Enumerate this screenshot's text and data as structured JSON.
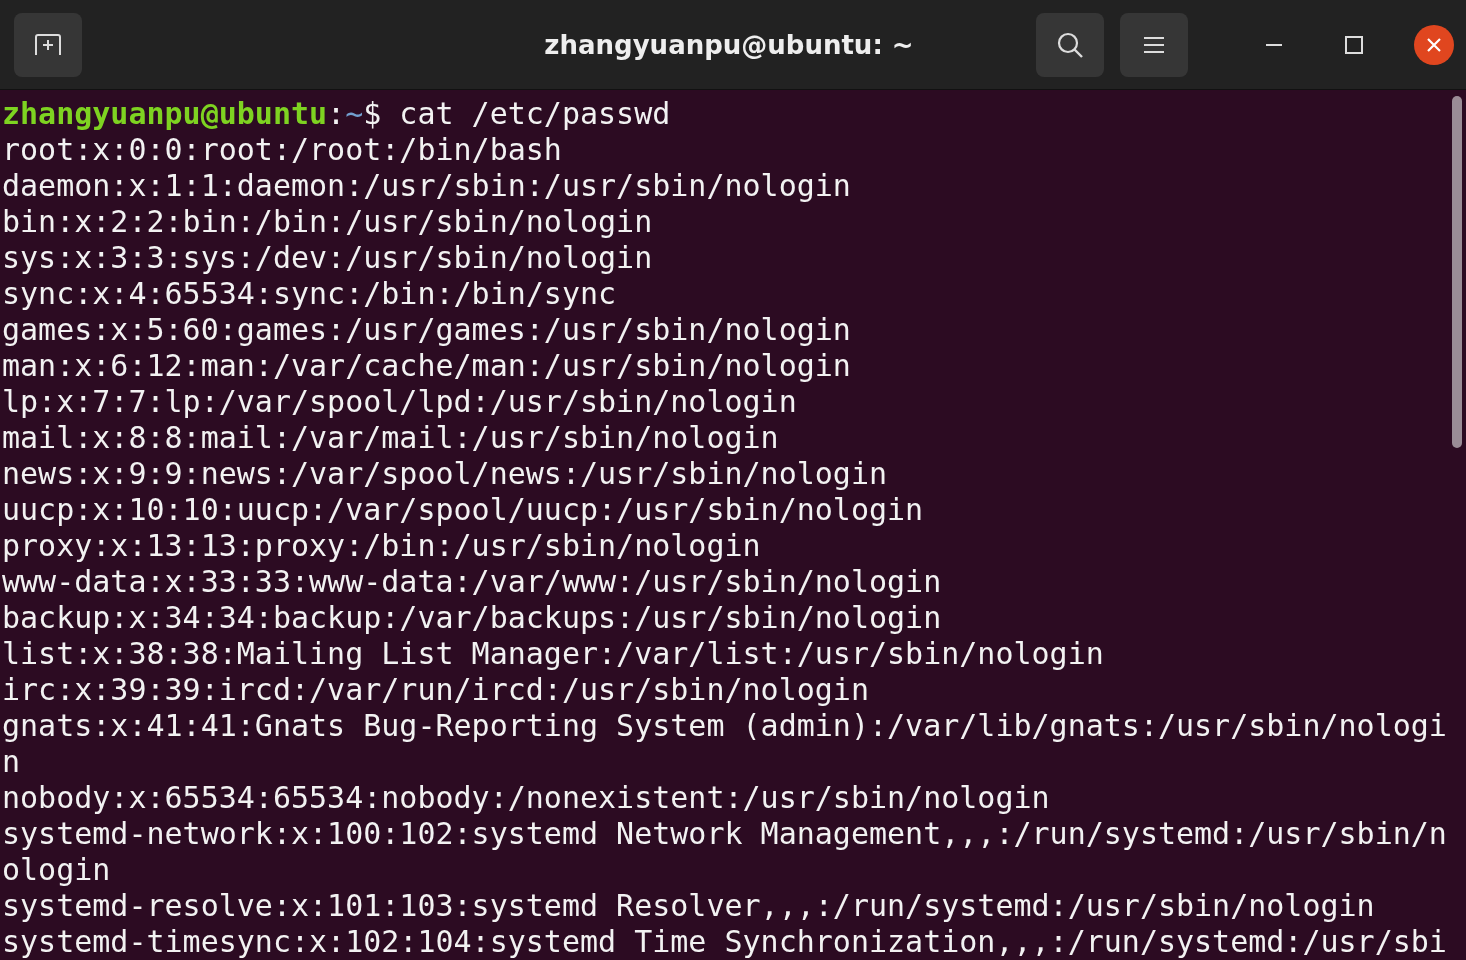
{
  "window": {
    "title": "zhangyuanpu@ubuntu: ~"
  },
  "prompt": {
    "user_host": "zhangyuanpu@ubuntu",
    "separator": ":",
    "path": "~",
    "symbol": "$",
    "command": "cat /etc/passwd"
  },
  "output": [
    "root:x:0:0:root:/root:/bin/bash",
    "daemon:x:1:1:daemon:/usr/sbin:/usr/sbin/nologin",
    "bin:x:2:2:bin:/bin:/usr/sbin/nologin",
    "sys:x:3:3:sys:/dev:/usr/sbin/nologin",
    "sync:x:4:65534:sync:/bin:/bin/sync",
    "games:x:5:60:games:/usr/games:/usr/sbin/nologin",
    "man:x:6:12:man:/var/cache/man:/usr/sbin/nologin",
    "lp:x:7:7:lp:/var/spool/lpd:/usr/sbin/nologin",
    "mail:x:8:8:mail:/var/mail:/usr/sbin/nologin",
    "news:x:9:9:news:/var/spool/news:/usr/sbin/nologin",
    "uucp:x:10:10:uucp:/var/spool/uucp:/usr/sbin/nologin",
    "proxy:x:13:13:proxy:/bin:/usr/sbin/nologin",
    "www-data:x:33:33:www-data:/var/www:/usr/sbin/nologin",
    "backup:x:34:34:backup:/var/backups:/usr/sbin/nologin",
    "list:x:38:38:Mailing List Manager:/var/list:/usr/sbin/nologin",
    "irc:x:39:39:ircd:/var/run/ircd:/usr/sbin/nologin",
    "gnats:x:41:41:Gnats Bug-Reporting System (admin):/var/lib/gnats:/usr/sbin/nologin",
    "nobody:x:65534:65534:nobody:/nonexistent:/usr/sbin/nologin",
    "systemd-network:x:100:102:systemd Network Management,,,:/run/systemd:/usr/sbin/nologin",
    "systemd-resolve:x:101:103:systemd Resolver,,,:/run/systemd:/usr/sbin/nologin",
    "systemd-timesync:x:102:104:systemd Time Synchronization,,,:/run/systemd:/usr/sbi"
  ]
}
